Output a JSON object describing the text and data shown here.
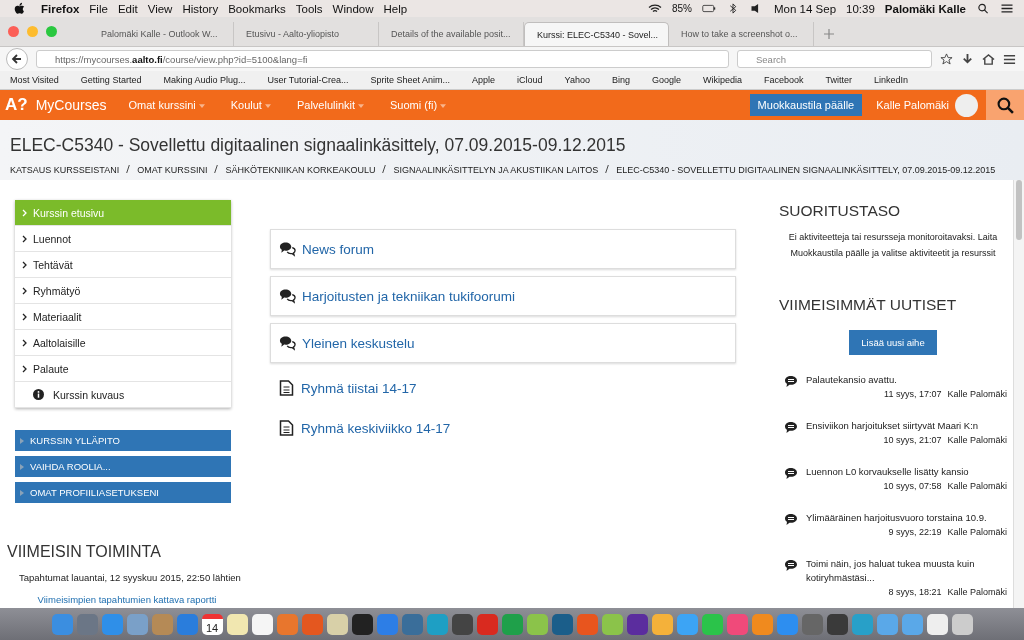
{
  "menubar": {
    "app": "Firefox",
    "menus": [
      "File",
      "Edit",
      "View",
      "History",
      "Bookmarks",
      "Tools",
      "Window",
      "Help"
    ],
    "battery": "85%",
    "date": "Mon 14 Sep",
    "time": "10:39",
    "user": "Palomäki Kalle"
  },
  "tabs": [
    {
      "title": "Palomäki Kalle - Outlook W...",
      "selected": false
    },
    {
      "title": "Etusivu - Aalto-yliopisto",
      "selected": false
    },
    {
      "title": "Details of the available posit...",
      "selected": false
    },
    {
      "title": "Kurssi: ELEC-C5340 - Sovel...",
      "selected": true
    },
    {
      "title": "How to take a screenshot o...",
      "selected": false
    }
  ],
  "url": "https://mycourses.**aalto.fi**/course/view.php?id=5100&lang=fi",
  "search": {
    "placeholder": "Search"
  },
  "bookmarks": [
    "Most Visited",
    "Getting Started",
    "Making Audio Plug...",
    "User Tutorial-Crea...",
    "Sprite Sheet Anim...",
    "Apple",
    "iCloud",
    "Yahoo",
    "Bing",
    "Google",
    "Wikipedia",
    "Facebook",
    "Twitter",
    "LinkedIn"
  ],
  "site_nav": {
    "logo": "A?",
    "brand": "MyCourses",
    "menus": [
      "Omat kurssini",
      "Koulut",
      "Palvelulinkit",
      "Suomi (fi)"
    ],
    "edit_button": "Muokkaustila päälle",
    "user": "Kalle Palomäki"
  },
  "page_title": "ELEC-C5340 - Sovellettu digitaalinen signaalinkäsittely, 07.09.2015-09.12.2015",
  "breadcrumbs": [
    "KATSAUS KURSSEISTANI",
    "OMAT KURSSINI",
    "SÄHKÖTEKNIIKAN KORKEAKOULU",
    "SIGNAALINKÄSITTELYN JA AKUSTIIKAN LAITOS",
    "ELEC-C5340 - SOVELLETTU DIGITAALINEN SIGNAALINKÄSITTELY, 07.09.2015-09.12.2015"
  ],
  "course_nav": [
    {
      "label": "Kurssin etusivu",
      "kind": "section",
      "selected": true
    },
    {
      "label": "Luennot",
      "kind": "section",
      "selected": false
    },
    {
      "label": "Tehtävät",
      "kind": "section",
      "selected": false
    },
    {
      "label": "Ryhmätyö",
      "kind": "section",
      "selected": false
    },
    {
      "label": "Materiaalit",
      "kind": "section",
      "selected": false
    },
    {
      "label": "Aaltolaisille",
      "kind": "section",
      "selected": false
    },
    {
      "label": "Palaute",
      "kind": "section",
      "selected": false
    },
    {
      "label": "Kurssin kuvaus",
      "kind": "info",
      "selected": false
    }
  ],
  "blocks": [
    "KURSSIN YLLÄPITO",
    "VAIHDA ROOLIA...",
    "OMAT PROFIILIASETUKSENI"
  ],
  "recent_activity": {
    "title": "VIIMEISIN TOIMINTA",
    "since": "Tapahtumat lauantai, 12 syyskuu 2015, 22:50 lähtien",
    "link": "Viimeisimpien tapahtumien kattava raportti"
  },
  "activities": [
    {
      "kind": "forum",
      "label": "News forum"
    },
    {
      "kind": "forum",
      "label": "Harjoitusten ja tekniikan tukifoorumi"
    },
    {
      "kind": "forum",
      "label": "Yleinen keskustelu"
    },
    {
      "kind": "page",
      "label": "Ryhmä tiistai 14-17"
    },
    {
      "kind": "page",
      "label": "Ryhmä keskiviikko 14-17"
    }
  ],
  "progress": {
    "title": "SUORITUSTASO",
    "text": "Ei aktiviteetteja tai resursseja monitoroitavaksi. Laita Muokkaustila päälle ja valitse aktiviteetit ja resurssit"
  },
  "news": {
    "title": "VIIMEISIMMÄT UUTISET",
    "button": "Lisää uusi aihe",
    "items": [
      {
        "title": "Palautekansio avattu.",
        "date": "11 syys, 17:07",
        "author": "Kalle Palomäki"
      },
      {
        "title": "Ensiviikon harjoitukset siirtyvät Maari K:n",
        "date": "10 syys, 21:07",
        "author": "Kalle Palomäki"
      },
      {
        "title": "Luennon L0 korvaukselle lisätty kansio",
        "date": "10 syys, 07:58",
        "author": "Kalle Palomäki"
      },
      {
        "title": "Ylimääräinen harjoitusvuoro torstaina 10.9.",
        "date": "9 syys, 22:19",
        "author": "Kalle Palomäki"
      },
      {
        "title": "Toimi näin, jos haluat tukea muusta kuin kotiryhmästäsi...",
        "date": "8 syys, 18:21",
        "author": "Kalle Palomäki"
      }
    ]
  },
  "dock": {
    "calendar_day": "14"
  }
}
